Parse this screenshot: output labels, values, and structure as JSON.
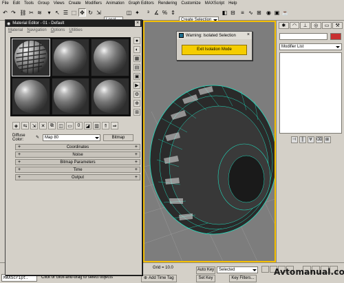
{
  "menu": [
    "File",
    "Edit",
    "Tools",
    "Group",
    "Views",
    "Create",
    "Modifiers",
    "Animation",
    "Graph Editors",
    "Rendering",
    "Customize",
    "MAXScript",
    "Help"
  ],
  "toolbar": {
    "coordinate_system": "Local",
    "named_selection_placeholder": "Create Selection Set",
    "icons": [
      "undo-icon",
      "redo-icon",
      "link-icon",
      "unlink-icon",
      "bind-space-warp-icon",
      "select-filter",
      "select-object-icon",
      "select-by-name-icon",
      "selection-region-icon",
      "window-crossing-icon",
      "select-move-icon",
      "select-rotate-icon",
      "select-scale-icon",
      "pivot-icon",
      "manipulate-icon",
      "snap-icon",
      "angle-snap-icon",
      "percent-snap-icon",
      "spinner-snap-icon",
      "mirror-icon",
      "align-icon",
      "layer-icon",
      "curve-editor-icon",
      "schematic-icon",
      "material-editor-icon",
      "render-setup-icon",
      "quick-render-icon"
    ]
  },
  "material_editor": {
    "title": "Material Editor - 01 - Default",
    "menu": [
      "Material",
      "Navigation",
      "Options",
      "Utilities"
    ],
    "diffuse_label": "Diffuse Color:",
    "map_name": "Map 80",
    "bitmap_button": "Bitmap",
    "rollouts": [
      "Coordinates",
      "Noise",
      "Bitmap Parameters",
      "Time",
      "Output"
    ]
  },
  "warning": {
    "title": "Warning: Isolated Selection",
    "button": "Exit Isolation Mode"
  },
  "command_panel": {
    "modifier_list": "Modifier List"
  },
  "status": {
    "maxscript": "MAXScript.",
    "prompt": "Click or click-and-drag to select objects",
    "grid": "Grid = 10.0",
    "add_time_tag": "Add Time Tag",
    "auto_key": "Auto Key",
    "selected": "Selected",
    "set_key": "Set Key",
    "key_filters": "Key Filters..."
  },
  "watermark": "Avtomanual.com",
  "colors": {
    "viewport_border": "#f5c000",
    "exit_button": "#f5cd00",
    "wireframe": "#20e0c0",
    "viewport_bg": "#7d7d7d"
  }
}
